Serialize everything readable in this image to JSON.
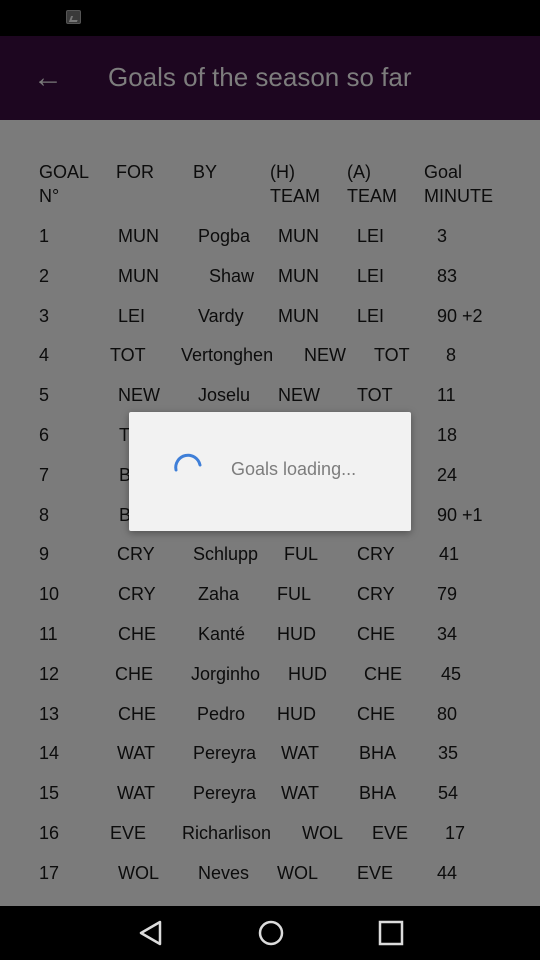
{
  "app": {
    "title": "Goals of the season so far",
    "back_icon": "arrow-left-icon"
  },
  "status_bar": {
    "icon": "image-icon"
  },
  "table": {
    "headers": [
      "GOAL\nN°",
      "FOR",
      "BY",
      "(H)\nTEAM",
      "(A)\nTEAM",
      "Goal\nMINUTE"
    ],
    "rows": [
      [
        "1",
        "MUN",
        "Pogba",
        "MUN",
        "LEI",
        "3"
      ],
      [
        "2",
        "MUN",
        "Shaw",
        "MUN",
        "LEI",
        "83"
      ],
      [
        "3",
        "LEI",
        "Vardy",
        "MUN",
        "LEI",
        "90 +2"
      ],
      [
        "4",
        "TOT",
        "Vertonghen",
        "NEW",
        "TOT",
        "8"
      ],
      [
        "5",
        "NEW",
        "Joselu",
        "NEW",
        "TOT",
        "11"
      ],
      [
        "6",
        "T",
        "",
        "",
        "",
        "18"
      ],
      [
        "7",
        "B",
        "",
        "",
        "",
        "24"
      ],
      [
        "8",
        "B",
        "",
        "",
        "",
        "90 +1"
      ],
      [
        "9",
        "CRY",
        "Schlupp",
        "FUL",
        "CRY",
        "41"
      ],
      [
        "10",
        "CRY",
        "Zaha",
        "FUL",
        "CRY",
        "79"
      ],
      [
        "11",
        "CHE",
        "Kanté",
        "HUD",
        "CHE",
        "34"
      ],
      [
        "12",
        "CHE",
        "Jorginho",
        "HUD",
        "CHE",
        "45"
      ],
      [
        "13",
        "CHE",
        "Pedro",
        "HUD",
        "CHE",
        "80"
      ],
      [
        "14",
        "WAT",
        "Pereyra",
        "WAT",
        "BHA",
        "35"
      ],
      [
        "15",
        "WAT",
        "Pereyra",
        "WAT",
        "BHA",
        "54"
      ],
      [
        "16",
        "EVE",
        "Richarlison",
        "WOL",
        "EVE",
        "17"
      ],
      [
        "17",
        "WOL",
        "Neves",
        "WOL",
        "EVE",
        "44"
      ]
    ]
  },
  "dialog": {
    "message": "Goals loading...",
    "spinner_icon": "loading-spinner-icon",
    "accent_color": "#3f7fd8"
  },
  "nav_bar": {
    "back_icon": "nav-back-icon",
    "home_icon": "nav-home-icon",
    "recents_icon": "nav-recents-icon"
  },
  "colors": {
    "app_bar": "#1d0620",
    "content_dim": "#7b7b7b",
    "dialog_bg": "#f2f2f2"
  }
}
